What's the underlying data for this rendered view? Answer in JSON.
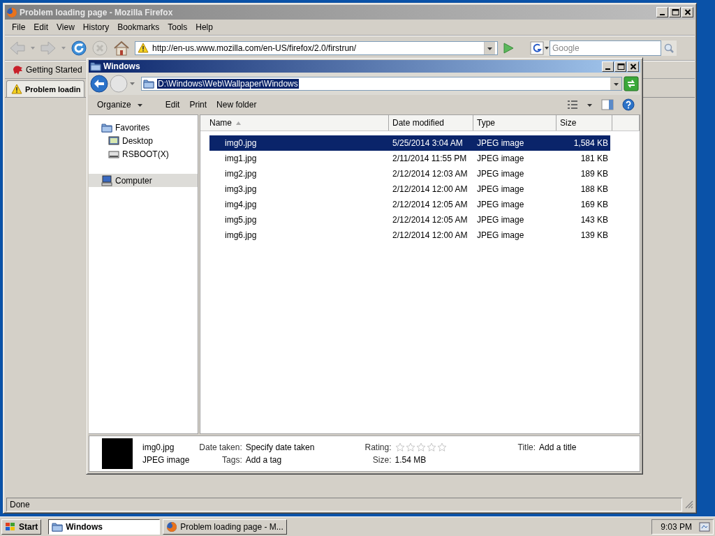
{
  "firefox": {
    "title": "Problem loading page - Mozilla Firefox",
    "menu": [
      "File",
      "Edit",
      "View",
      "History",
      "Bookmarks",
      "Tools",
      "Help"
    ],
    "url": "http://en-us.www.mozilla.com/en-US/firefox/2.0/firstrun/",
    "search": {
      "placeholder": "Google"
    },
    "bookmarks": [
      "Getting Started"
    ],
    "tabs": [
      {
        "label": "Problem loadin",
        "selected": true
      }
    ],
    "status": "Done"
  },
  "explorer": {
    "title": "Windows",
    "address": "D:\\Windows\\Web\\Wallpaper\\Windows",
    "toolbar": [
      {
        "label": "Organize",
        "kind": "menu"
      },
      {
        "label": "Edit",
        "kind": "button"
      },
      {
        "label": "Print",
        "kind": "button"
      },
      {
        "label": "New folder",
        "kind": "button"
      }
    ],
    "nav": [
      {
        "label": "Favorites",
        "kind": "favorites",
        "selected": false,
        "children": [
          {
            "label": "Desktop",
            "kind": "desktop",
            "selected": false
          },
          {
            "label": "RSBOOT(X)",
            "kind": "drive",
            "selected": false
          }
        ]
      },
      {
        "label": "Computer",
        "kind": "computer",
        "selected": true
      }
    ],
    "columns": [
      "Name",
      "Date modified",
      "Type",
      "Size"
    ],
    "rows": [
      {
        "name": "img0.jpg",
        "date": "5/25/2014 3:04 AM",
        "type": "JPEG image",
        "size": "1,584 KB",
        "selected": true
      },
      {
        "name": "img1.jpg",
        "date": "2/11/2014 11:55 PM",
        "type": "JPEG image",
        "size": "181 KB",
        "selected": false
      },
      {
        "name": "img2.jpg",
        "date": "2/12/2014 12:03 AM",
        "type": "JPEG image",
        "size": "189 KB",
        "selected": false
      },
      {
        "name": "img3.jpg",
        "date": "2/12/2014 12:00 AM",
        "type": "JPEG image",
        "size": "188 KB",
        "selected": false
      },
      {
        "name": "img4.jpg",
        "date": "2/12/2014 12:05 AM",
        "type": "JPEG image",
        "size": "169 KB",
        "selected": false
      },
      {
        "name": "img5.jpg",
        "date": "2/12/2014 12:05 AM",
        "type": "JPEG image",
        "size": "143 KB",
        "selected": false
      },
      {
        "name": "img6.jpg",
        "date": "2/12/2014 12:00 AM",
        "type": "JPEG image",
        "size": "139 KB",
        "selected": false
      }
    ],
    "details": {
      "name": "img0.jpg",
      "type": "JPEG image",
      "groups": [
        [
          {
            "label": "Date taken:",
            "value": "Specify date taken"
          },
          {
            "label": "Tags:",
            "value": "Add a tag"
          }
        ],
        [
          {
            "label": "Rating:",
            "stars": 0
          },
          {
            "label": "Size:",
            "value": "1.54 MB"
          }
        ],
        [
          {
            "label": "Title:",
            "value": "Add a title"
          }
        ]
      ]
    }
  },
  "taskbar": {
    "start": "Start",
    "tasks": [
      {
        "label": "Windows",
        "kind": "folder",
        "selected": true
      },
      {
        "label": "Problem loading page - M...",
        "kind": "browser",
        "selected": false
      }
    ],
    "clock": "9:03 PM"
  }
}
